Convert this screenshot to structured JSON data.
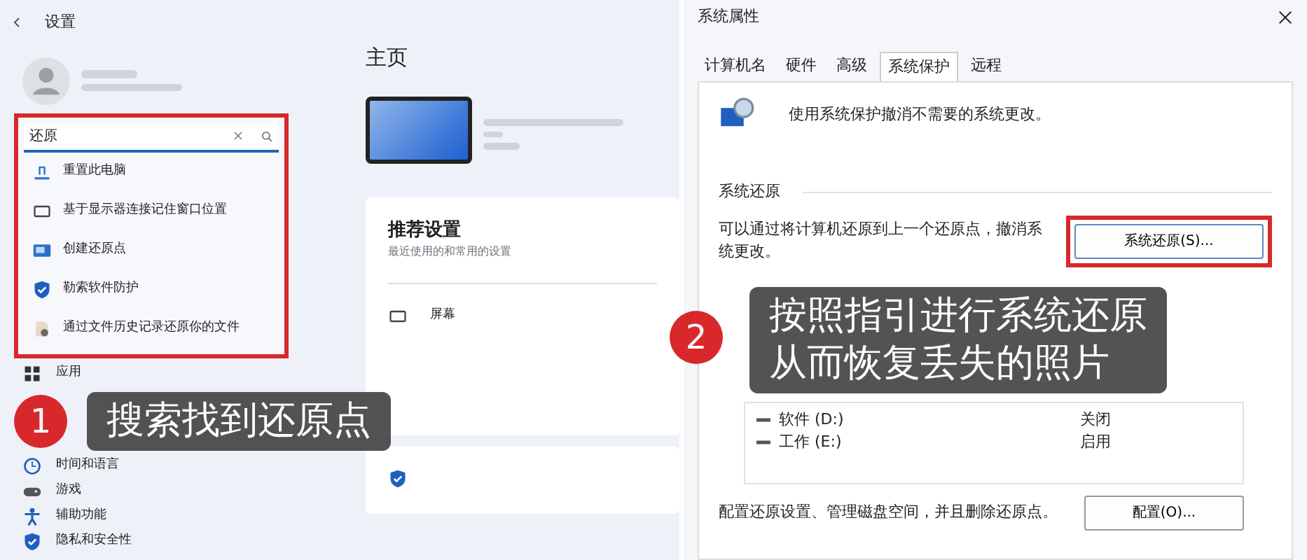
{
  "settings_window": {
    "title": "设置",
    "search": {
      "value": "还原"
    },
    "search_results": [
      {
        "label": "重置此电脑",
        "kind": "reset"
      },
      {
        "label": "基于显示器连接记住窗口位置",
        "kind": "monitor"
      },
      {
        "label": "创建还原点",
        "kind": "restore"
      },
      {
        "label": "勒索软件防护",
        "kind": "shield"
      },
      {
        "label": "通过文件历史记录还原你的文件",
        "kind": "history"
      }
    ],
    "nav_items": [
      {
        "label": "应用",
        "kind": "apps"
      },
      {
        "label": "时间和语言",
        "kind": "clock"
      },
      {
        "label": "游戏",
        "kind": "game"
      },
      {
        "label": "辅助功能",
        "kind": "person"
      },
      {
        "label": "隐私和安全性",
        "kind": "shield"
      }
    ],
    "page_title": "主页",
    "recommended": {
      "title": "推荐设置",
      "subtitle": "最近使用的和常用的设置",
      "items": [
        {
          "label": "屏幕"
        }
      ]
    }
  },
  "system_properties": {
    "title": "系统属性",
    "tabs": [
      {
        "label": "计算机名",
        "selected": false
      },
      {
        "label": "硬件",
        "selected": false
      },
      {
        "label": "高级",
        "selected": false
      },
      {
        "label": "系统保护",
        "selected": true
      },
      {
        "label": "远程",
        "selected": false
      }
    ],
    "description": "使用系统保护撤消不需要的系统更改。",
    "restore_section": {
      "title": "系统还原",
      "text": "可以通过将计算机还原到上一个还原点，撤消系统更改。",
      "button": "系统还原(S)..."
    },
    "drives": [
      {
        "name": "软件 (D:)",
        "protection": "关闭"
      },
      {
        "name": "工作 (E:)",
        "protection": "启用"
      }
    ],
    "configure_text": "配置还原设置、管理磁盘空间，并且删除还原点。",
    "configure_button": "配置(O)..."
  },
  "callouts": [
    {
      "number": "1",
      "lines": [
        "搜索找到还原点"
      ]
    },
    {
      "number": "2",
      "lines": [
        "按照指引进行系统还原",
        "从而恢复丢失的照片"
      ]
    }
  ]
}
